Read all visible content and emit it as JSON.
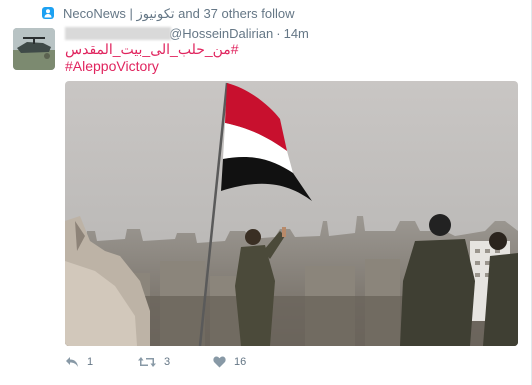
{
  "social_context": {
    "icon": "follow-icon",
    "text": "NecoNews | تکونیوز and 37 others follow"
  },
  "tweet": {
    "handle": "@HosseinDalirian",
    "separator": "·",
    "time": "14m",
    "hashtags": [
      "#من_حلب_الى_بيت_المقدس",
      "#AleppoVictory"
    ],
    "photo": "photo of soldiers raising a Syrian flag over a city",
    "actions": {
      "reply": {
        "icon": "reply-icon",
        "count": "1"
      },
      "retweet": {
        "icon": "retweet-icon",
        "count": "3"
      },
      "like": {
        "icon": "heart-icon",
        "count": "16"
      }
    }
  },
  "colors": {
    "hashtag": "#e0245e",
    "secondary_text": "#657786",
    "accent": "#1da1f2"
  }
}
